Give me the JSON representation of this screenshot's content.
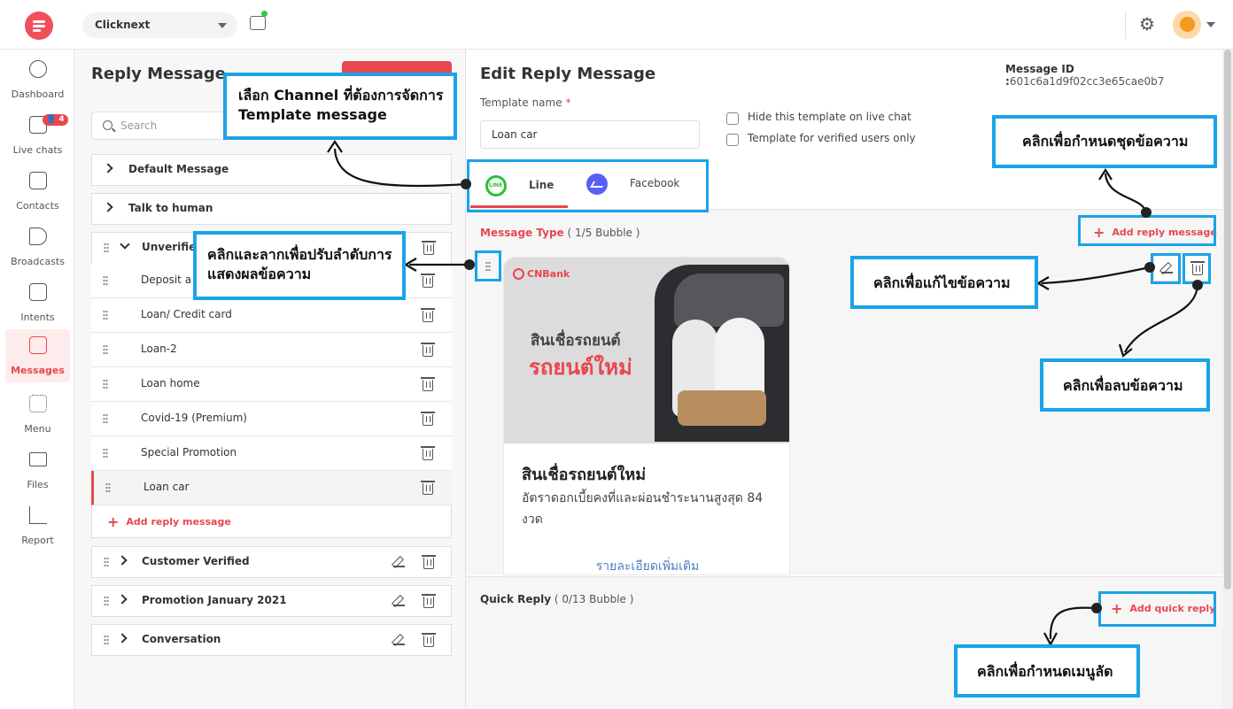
{
  "topbar": {
    "workspace": "Clicknext"
  },
  "nav": [
    {
      "label": "Dashboard"
    },
    {
      "label": "Live chats",
      "badge": "4"
    },
    {
      "label": "Contacts"
    },
    {
      "label": "Broadcasts"
    },
    {
      "label": "Intents"
    },
    {
      "label": "Messages"
    },
    {
      "label": "Menu"
    },
    {
      "label": "Files"
    },
    {
      "label": "Report"
    }
  ],
  "middle": {
    "title": "Reply Message",
    "search_placeholder": "Search",
    "groups": {
      "default": "Default Message",
      "talk": "Talk to human",
      "unverified": "Unverified",
      "customer": "Customer Verified",
      "promotion": "Promotion January 2021",
      "conversation": "Conversation"
    },
    "items": [
      "Deposit a",
      "Loan/ Credit card",
      "Loan-2",
      "Loan home",
      "Covid-19 (Premium)",
      "Special Promotion",
      "Loan car"
    ],
    "add_reply": "Add reply message"
  },
  "editor": {
    "title": "Edit Reply Message",
    "message_id_label": "Message ID :",
    "message_id": "601c6a1d9f02cc3e65cae0b7",
    "template_label": "Template name",
    "template_required": "*",
    "template_value": "Loan car",
    "hide_label": "Hide this template on live chat",
    "verified_label": "Template for verified users only",
    "tabs": {
      "line": "Line",
      "facebook": "Facebook",
      "line_icon_text": "LINE"
    },
    "message_type_label": "Message Type",
    "message_type_count": "( 1/5 Bubble )",
    "add_reply": "Add reply message",
    "quick_reply_label": "Quick Reply",
    "quick_reply_count": "( 0/13 Bubble )",
    "add_quick": "Add quick reply"
  },
  "card": {
    "brand": "CNBank",
    "img_line1": "สินเชื่อรถยนต์",
    "img_line2": "รถยนต์ใหม่",
    "title": "สินเชื่อรถยนต์ใหม่",
    "description": "อัตราดอกเบี้ยคงที่และผ่อนชำระนานสูงสุด 84 งวด",
    "link": "รายละเอียดเพิ่มเติม"
  },
  "annotations": {
    "channel": "เลือก Channel ที่ต้องการจัดการ Template message",
    "drag": "คลิกและลากเพื่อปรับลำดับการแสดงผลข้อความ",
    "add_set": "คลิกเพื่อกำหนดชุดข้อความ",
    "edit": "คลิกเพื่อแก้ไขข้อความ",
    "delete": "คลิกเพื่อลบข้อความ",
    "quick_menu": "คลิกเพื่อกำหนดเมนูลัด"
  },
  "colors": {
    "accent": "#e8474f",
    "annotation": "#1aa3e8",
    "line_green": "#27c13a",
    "messenger": "#5a5ef8"
  }
}
